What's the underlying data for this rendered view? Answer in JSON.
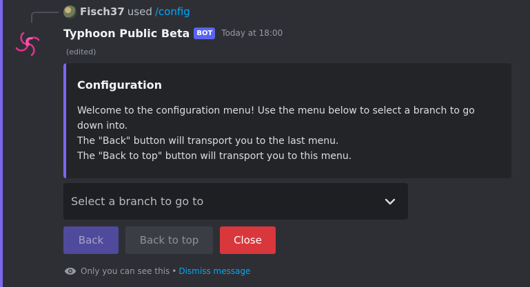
{
  "reply": {
    "username": "Fisch37",
    "used_text": "used",
    "command": "/config"
  },
  "message": {
    "author": "Typhoon Public Beta",
    "badge": "BOT",
    "timestamp": "Today at 18:00",
    "edited": "(edited)"
  },
  "embed": {
    "title": "Configuration",
    "description_lines": [
      "Welcome to the configuration menu! Use the menu below to select a branch to go",
      "down into.",
      "The \"Back\" button will transport you to the last menu.",
      "The \"Back to top\" button will transport you to this menu."
    ],
    "accent_color": "#7b68ee"
  },
  "select": {
    "placeholder": "Select a branch to go to",
    "icon": "chevron-down-icon"
  },
  "buttons": {
    "back": "Back",
    "back_to_top": "Back to top",
    "close": "Close"
  },
  "ephemeral": {
    "notice": "Only you can see this",
    "separator": "•",
    "dismiss": "Dismiss message",
    "icon": "eye-icon"
  },
  "colors": {
    "blurple": "#5865f2",
    "danger": "#da373c",
    "link": "#00a8fc"
  }
}
